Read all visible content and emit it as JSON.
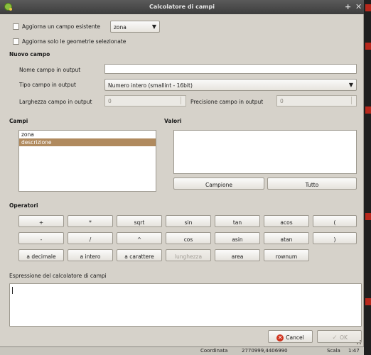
{
  "window": {
    "title": "Calcolatore di campi"
  },
  "top": {
    "update_existing_label": "Aggiorna un campo esistente",
    "field_combo_value": "zona",
    "selected_only_label": "Aggiorna solo le geometrie selezionate"
  },
  "new_field": {
    "heading": "Nuovo campo",
    "name_label": "Nome campo in output",
    "name_value": "",
    "type_label": "Tipo campo in output",
    "type_value": "Numero intero (smallint - 16bit)",
    "width_label": "Larghezza campo in output",
    "width_value": "0",
    "precision_label": "Precisione campo in output",
    "precision_value": "0"
  },
  "fields": {
    "heading": "Campi",
    "items": [
      "zona",
      "descrizione"
    ],
    "selected_index": 1
  },
  "values": {
    "heading": "Valori",
    "sample_button": "Campione",
    "all_button": "Tutto"
  },
  "operators": {
    "heading": "Operatori",
    "row1": [
      "+",
      "*",
      "sqrt",
      "sin",
      "tan",
      "acos",
      "("
    ],
    "row2": [
      "-",
      "/",
      "^",
      "cos",
      "asin",
      "atan",
      ")"
    ],
    "row3": [
      "a decimale",
      "a intero",
      "a carattere",
      "lunghezza",
      "area",
      "rownum"
    ],
    "disabled": [
      "lunghezza"
    ]
  },
  "expression": {
    "heading": "Espressione del calcolatore di campi",
    "value": ""
  },
  "footer": {
    "cancel_label": "Cancel",
    "ok_label": "OK"
  },
  "statusbar": {
    "coord_label": "Coordinata",
    "coord_value": "2770999,4406990",
    "scale_label": "Scala",
    "scale_value": "1:47"
  }
}
